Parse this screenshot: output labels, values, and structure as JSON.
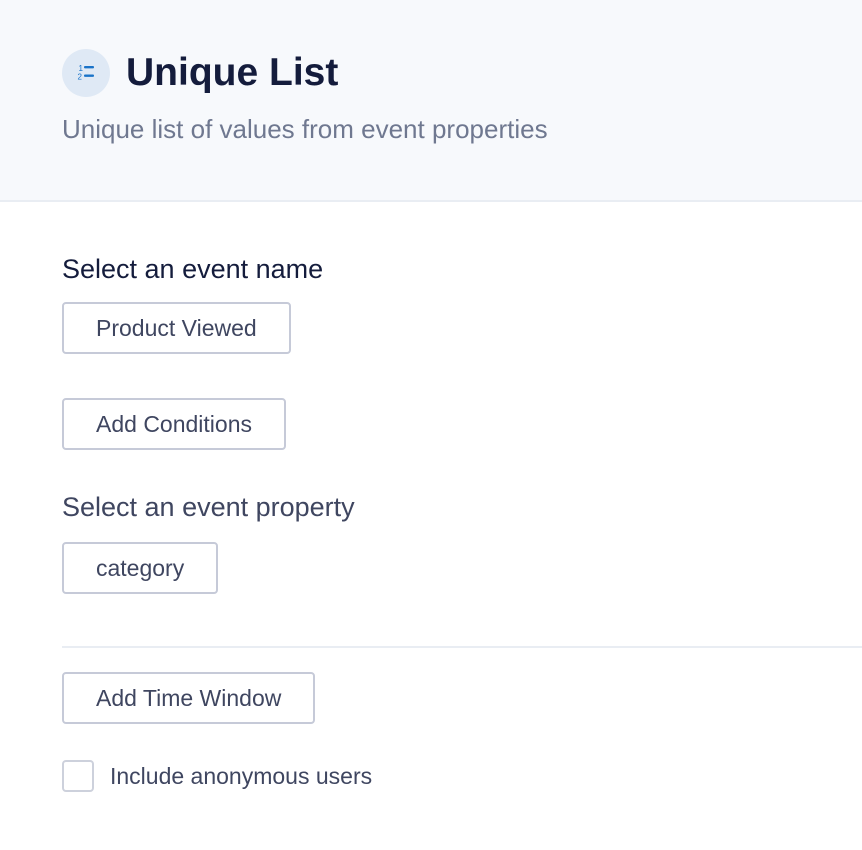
{
  "header": {
    "icon": "numbered-list-icon",
    "title": "Unique List",
    "subtitle": "Unique list of values from event properties"
  },
  "event_name": {
    "label": "Select an event name",
    "selected_value": "Product Viewed"
  },
  "conditions": {
    "button_label": "Add Conditions"
  },
  "event_property": {
    "label": "Select an event property",
    "selected_value": "category"
  },
  "time_window": {
    "button_label": "Add Time Window"
  },
  "anonymous": {
    "label": "Include anonymous users",
    "checked": false
  },
  "colors": {
    "title": "#141c3c",
    "icon_accent": "#1a73c8",
    "icon_bg": "#dfe9f5",
    "header_bg": "#f7f9fc"
  }
}
